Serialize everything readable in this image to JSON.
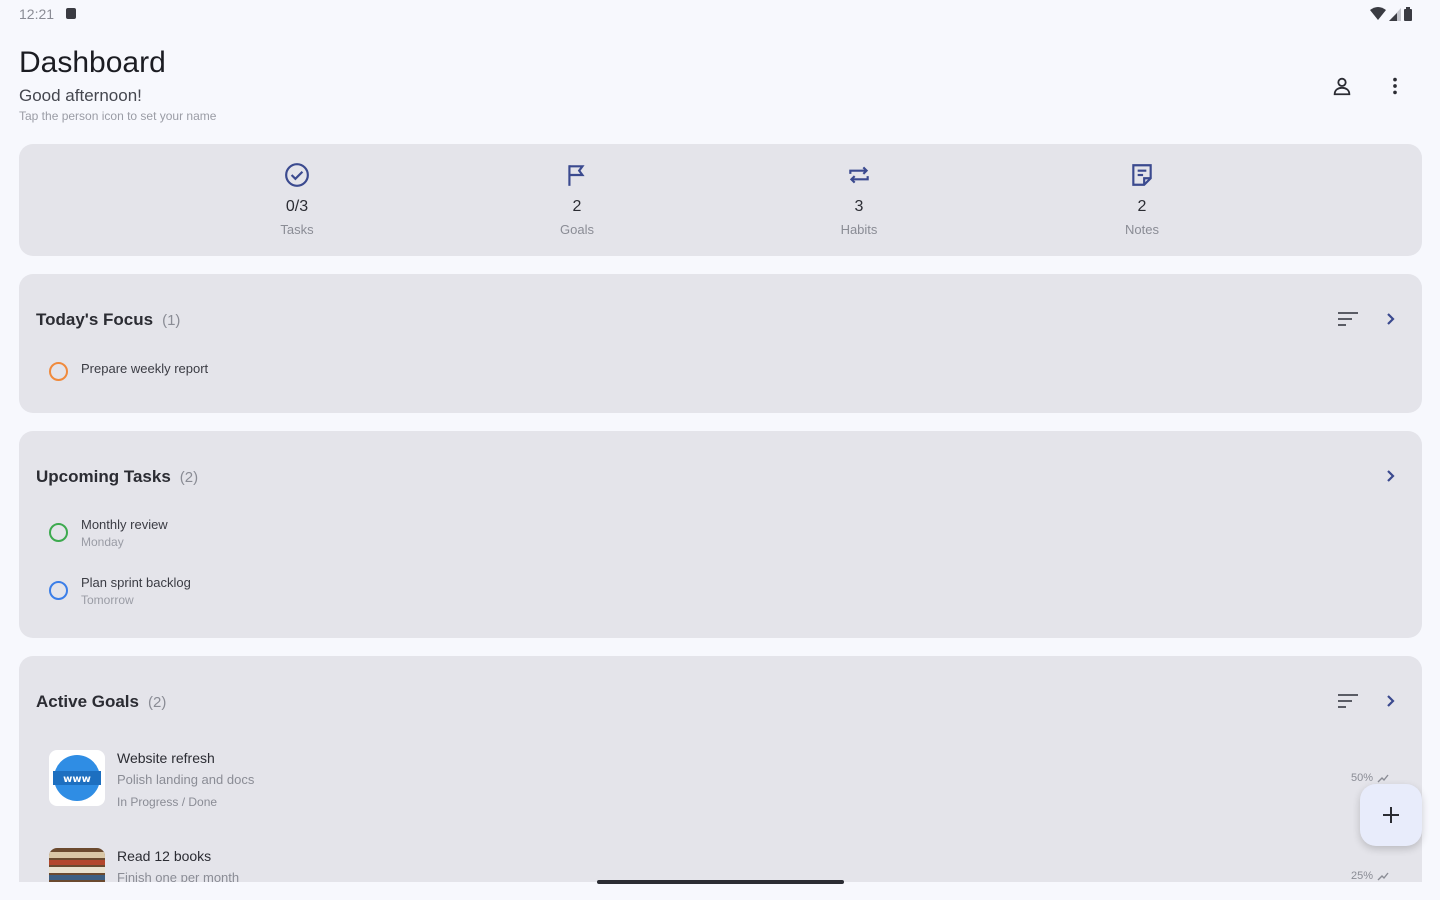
{
  "status_bar": {
    "time": "12:21"
  },
  "header": {
    "title": "Dashboard",
    "greeting": "Good afternoon!",
    "hint": "Tap the person icon to set your name",
    "profile_icon": "person-icon",
    "menu_icon": "more-vert-icon"
  },
  "stats": [
    {
      "icon": "check-circle-icon",
      "value": "0/3",
      "label": "Tasks"
    },
    {
      "icon": "flag-icon",
      "value": "2",
      "label": "Goals"
    },
    {
      "icon": "repeat-icon",
      "value": "3",
      "label": "Habits"
    },
    {
      "icon": "note-icon",
      "value": "2",
      "label": "Notes"
    }
  ],
  "focus": {
    "title": "Today's Focus",
    "count": "(1)",
    "items": [
      {
        "title": "Prepare weekly report",
        "color": "#f08a3c"
      }
    ]
  },
  "upcoming": {
    "title": "Upcoming Tasks",
    "count": "(2)",
    "items": [
      {
        "title": "Monthly review",
        "sub": "Monday",
        "color": "#3daa4f"
      },
      {
        "title": "Plan sprint backlog",
        "sub": "Tomorrow",
        "color": "#3b7ee8"
      }
    ]
  },
  "goals": {
    "title": "Active Goals",
    "count": "(2)",
    "items": [
      {
        "title": "Website refresh",
        "desc": "Polish landing and docs",
        "status": "In Progress / Done",
        "progress": "50%",
        "thumb": "globe-www-icon"
      },
      {
        "title": "Read 12 books",
        "desc": "Finish one per month",
        "progress": "25%",
        "thumb": "books-image"
      }
    ]
  },
  "colors": {
    "accent": "#3b4a8f",
    "background": "#f7f8fd",
    "card": "#e4e4ea",
    "fab": "#e8ecfb"
  }
}
